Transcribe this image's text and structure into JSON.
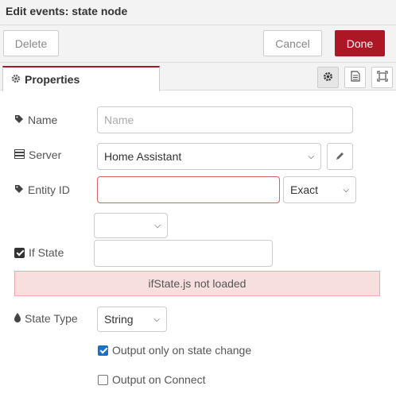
{
  "header": {
    "title": "Edit events: state node"
  },
  "toolbar": {
    "delete_label": "Delete",
    "cancel_label": "Cancel",
    "done_label": "Done"
  },
  "tabs": [
    {
      "label": "Properties",
      "icon": "gear-icon"
    }
  ],
  "tab_buttons": [
    "gear-icon",
    "document-icon",
    "frame-icon"
  ],
  "form": {
    "name": {
      "label": "Name",
      "placeholder": "Name",
      "value": ""
    },
    "server": {
      "label": "Server",
      "value": "Home Assistant"
    },
    "entity_id": {
      "label": "Entity ID",
      "value": "",
      "match_type": "Exact"
    },
    "if_state": {
      "label": "If State",
      "operator": "",
      "value": "",
      "checked": true
    },
    "alert": "ifState.js not loaded",
    "state_type": {
      "label": "State Type",
      "value": "String"
    },
    "output_only_on_change": {
      "label": "Output only on state change",
      "checked": true
    },
    "output_on_connect": {
      "label": "Output on Connect",
      "checked": false
    }
  },
  "colors": {
    "primary": "#ad1625",
    "error_border": "#d6615f",
    "alert_bg": "#f8dfdf",
    "checkbox": "#1a6fc9"
  }
}
